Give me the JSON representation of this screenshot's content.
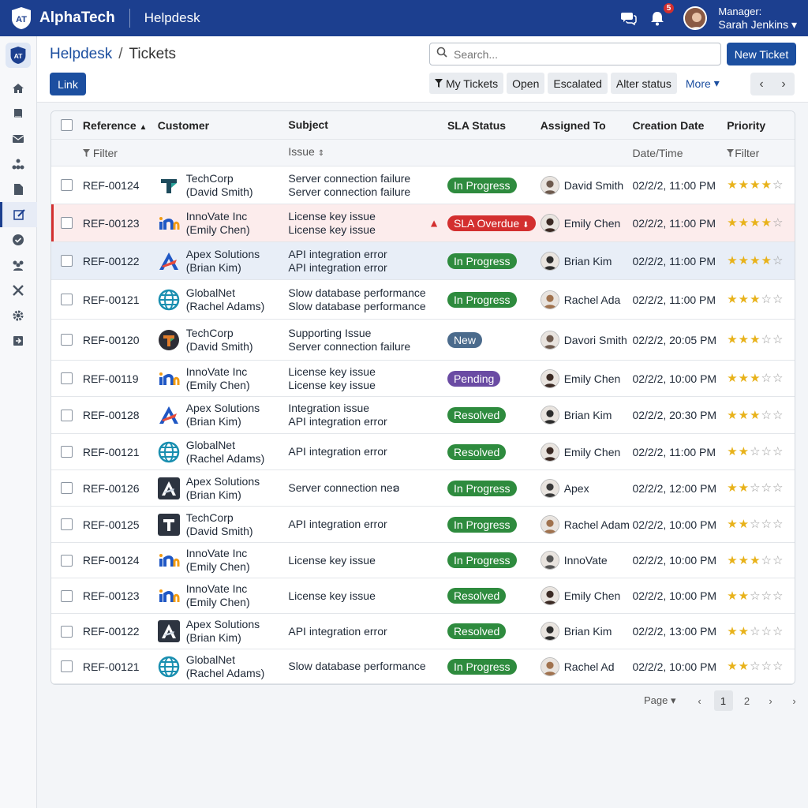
{
  "topbar": {
    "logo_text": "AT",
    "brand": "AlphaTech",
    "app": "Helpdesk",
    "notif_count": "5",
    "manager_label": "Manager:",
    "manager_name": "Sarah Jenkins"
  },
  "breadcrumb": {
    "root": "Helpdesk",
    "sep": "/",
    "current": "Tickets"
  },
  "search": {
    "placeholder": "Search..."
  },
  "buttons": {
    "new_ticket": "New Ticket",
    "link": "Link"
  },
  "filters": [
    "My Tickets",
    "Open",
    "Escalated",
    "Alter status",
    "More"
  ],
  "table": {
    "headers": [
      "Reference",
      "Customer",
      "Subject",
      "SLA Status",
      "Assigned To",
      "Creation Date",
      "Priority"
    ],
    "subheaders": {
      "filter": "Filter",
      "issue": "Issue",
      "datetime": "Date/Time",
      "priority_filter": "Filter"
    },
    "rows": [
      {
        "ref": "REF-00124",
        "company": "TechCorp",
        "contact": "(David Smith)",
        "s1": "Server connection failure",
        "s2": "Server connection failure",
        "status": "In Progress",
        "stype": "progress",
        "assignee": "David Smith",
        "date": "02/2/2, 11:00 PM",
        "rating": 4,
        "logo": "techcorp",
        "state": "",
        "warn": false
      },
      {
        "ref": "REF-00123",
        "company": "InnoVate Inc",
        "contact": "(Emily Chen)",
        "s1": "License key issue",
        "s2": "License key issue",
        "status": "SLA Overdue",
        "stype": "overdue",
        "assignee": "Emily Chen",
        "date": "02/2/2, 11:00 PM",
        "rating": 4,
        "logo": "innovate",
        "state": "alert",
        "warn": true
      },
      {
        "ref": "REF-00122",
        "company": "Apex Solutions",
        "contact": "(Brian Kim)",
        "s1": "API integration error",
        "s2": "API integration error",
        "status": "In Progress",
        "stype": "progress",
        "assignee": "Brian Kim",
        "date": "02/2/2, 11:00 PM",
        "rating": 4,
        "logo": "apex",
        "state": "sel",
        "warn": false
      },
      {
        "ref": "REF-00121",
        "company": "GlobalNet",
        "contact": "(Rachel Adams)",
        "s1": "Slow database performance",
        "s2": "Slow database performance",
        "status": "In Progress",
        "stype": "progress",
        "assignee": "Rachel Ada",
        "date": "02/2/2, 11:00 PM",
        "rating": 3,
        "logo": "globalnet",
        "state": "",
        "warn": false
      },
      {
        "ref": "REF-00120",
        "company": "TechCorp",
        "contact": "(David Smith)",
        "s1": "Supporting Issue",
        "s2": "Server connection failure",
        "status": "New",
        "stype": "new",
        "assignee": "Davori Smith",
        "date": "02/2/2, 20:05 PM",
        "rating": 3,
        "logo": "techcorp2",
        "state": "",
        "warn": false
      },
      {
        "ref": "REF-00119",
        "company": "InnoVate Inc",
        "contact": "(Emily Chen)",
        "s1": "License key issue",
        "s2": "License key issue",
        "status": "Pending",
        "stype": "pending",
        "assignee": "Emily Chen",
        "date": "02/2/2, 10:00 PM",
        "rating": 3,
        "logo": "innovate",
        "state": "",
        "warn": false
      },
      {
        "ref": "REF-00128",
        "company": "Apex Solutions",
        "contact": "(Brian Kim)",
        "s1": "Integration issue",
        "s2": "API integration error",
        "status": "Resolved",
        "stype": "resolved",
        "assignee": "Brian Kim",
        "date": "02/2/2, 20:30 PM",
        "rating": 3,
        "logo": "apex",
        "state": "",
        "warn": false
      },
      {
        "ref": "REF-00121",
        "company": "GlobalNet",
        "contact": "(Rachel Adams)",
        "s1": "API integration error",
        "s2": "",
        "status": "Resolved",
        "stype": "resolved",
        "assignee": "Emily Chen",
        "date": "02/2/2, 11:00 PM",
        "rating": 2,
        "logo": "globalnet",
        "state": "",
        "warn": false
      },
      {
        "ref": "REF-00126",
        "company": "Apex Solutions",
        "contact": "(Brian Kim)",
        "s1": "Server connection neອ",
        "s2": "",
        "status": "In Progress",
        "stype": "progress",
        "assignee": "Apex",
        "date": "02/2/2, 12:00 PM",
        "rating": 2,
        "logo": "apexdark",
        "state": "",
        "warn": false
      },
      {
        "ref": "REF-00125",
        "company": "TechCorp",
        "contact": "(David Smith)",
        "s1": "API integration error",
        "s2": "",
        "status": "In Progress",
        "stype": "progress",
        "assignee": "Rachel Adam",
        "date": "02/2/2, 10:00 PM",
        "rating": 2,
        "logo": "techdark",
        "state": "",
        "warn": false
      },
      {
        "ref": "REF-00124",
        "company": "InnoVate Inc",
        "contact": "(Emily Chen)",
        "s1": "License key issue",
        "s2": "",
        "status": "In Progress",
        "stype": "progress",
        "assignee": "InnoVate",
        "date": "02/2/2, 10:00 PM",
        "rating": 3,
        "logo": "innovate",
        "state": "",
        "warn": false
      },
      {
        "ref": "REF-00123",
        "company": "InnoVate Inc",
        "contact": "(Emily Chen)",
        "s1": "License key issue",
        "s2": "",
        "status": "Resolved",
        "stype": "resolved",
        "assignee": "Emily Chen",
        "date": "02/2/2, 10:00 PM",
        "rating": 2,
        "logo": "innovate",
        "state": "",
        "warn": false
      },
      {
        "ref": "REF-00122",
        "company": "Apex Solutions",
        "contact": "(Brian Kim)",
        "s1": "API integration error",
        "s2": "",
        "status": "Resolved",
        "stype": "resolved",
        "assignee": "Brian Kim",
        "date": "02/2/2, 13:00 PM",
        "rating": 2,
        "logo": "apexdark",
        "state": "",
        "warn": false
      },
      {
        "ref": "REF-00121",
        "company": "GlobalNet",
        "contact": "(Rachel Adams)",
        "s1": "Slow database performance",
        "s2": "",
        "status": "In Progress",
        "stype": "progress",
        "assignee": "Rachel Ad",
        "date": "02/2/2, 10:00 PM",
        "rating": 2,
        "logo": "globalnet",
        "state": "",
        "warn": false
      }
    ]
  },
  "pagination": {
    "label": "Page",
    "pages": [
      "1",
      "2"
    ],
    "current": "1"
  },
  "colors": {
    "brand": "#1c3f8f",
    "progress": "#2e8b3e",
    "overdue": "#d32f2f",
    "pending": "#6a4ba3",
    "new": "#4b6b8c",
    "star": "#e8b21a"
  },
  "sidebar_icons": [
    "home-icon",
    "book-icon",
    "mail-icon",
    "org-chart-icon",
    "document-icon",
    "edit-icon",
    "check-circle-icon",
    "team-icon",
    "tools-icon",
    "gear-icon",
    "export-icon"
  ]
}
